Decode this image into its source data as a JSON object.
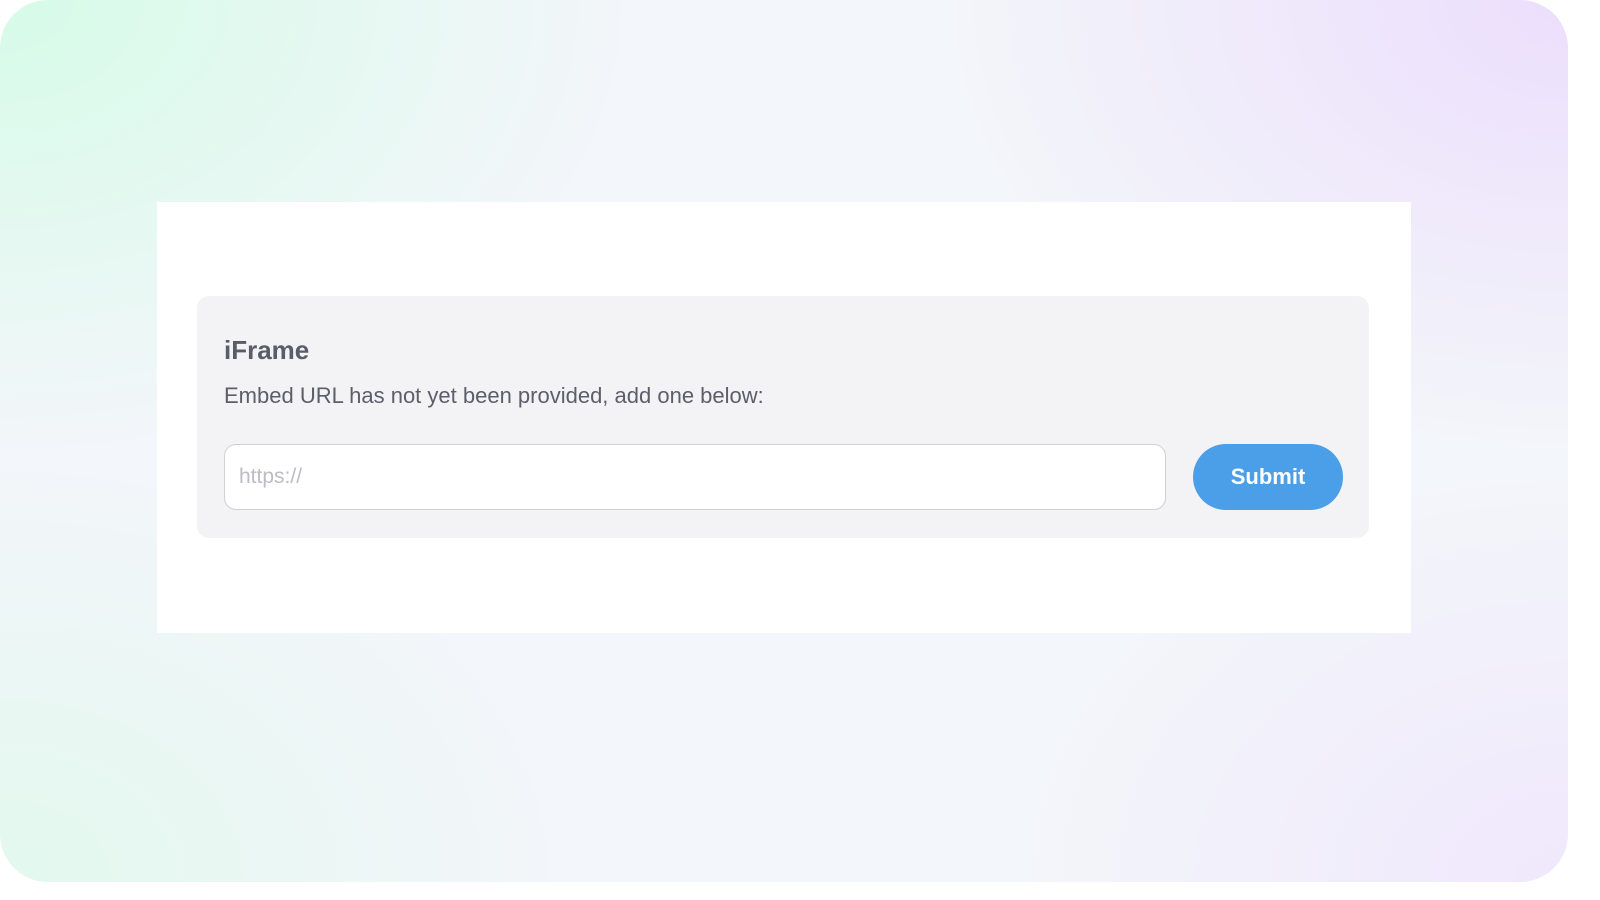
{
  "card": {
    "title": "iFrame",
    "message": "Embed URL has not yet been provided, add one below:"
  },
  "url_input": {
    "placeholder": "https://",
    "value": ""
  },
  "submit_button": {
    "label": "Submit"
  },
  "colors": {
    "accent": "#4a9fe8",
    "card_background": "#f3f3f5",
    "panel_background": "#ffffff"
  }
}
